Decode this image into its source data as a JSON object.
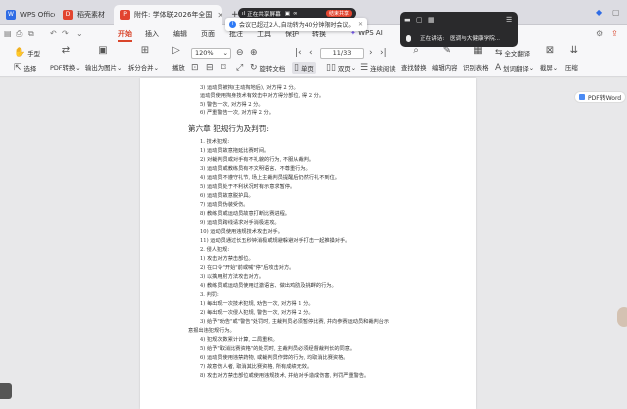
{
  "tabs": [
    {
      "label": "WPS Office"
    },
    {
      "label": "稻壳素材"
    },
    {
      "label": "附件: 学体联2026年全国"
    },
    {
      "label": "+"
    }
  ],
  "menubar": {
    "items": [
      "开始",
      "插入",
      "编辑",
      "页面",
      "批注",
      "工具",
      "保护",
      "转换",
      "WPS AI"
    ],
    "active": "开始"
  },
  "ribbon": {
    "hand_tool": "手型",
    "select_tool": "选择",
    "pdf_convert": "PDF转换",
    "export_image": "输出为图片",
    "split_merge": "拆分合并",
    "play": "播放",
    "zoom": "120%",
    "page_indicator": "11/33",
    "rotate_doc": "旋转文档",
    "single_page": "单页",
    "double_page": "双页",
    "continuous_read": "连续阅读",
    "find_replace": "查找替换",
    "edit_content": "编辑内容",
    "identify_table": "识别表格",
    "full_text_translate": "全文翻译",
    "word_translate": "划词翻译",
    "screenshot": "截屏",
    "compress": "压缩"
  },
  "screen_share": {
    "label": "正在共享屏幕",
    "end": "结束共享"
  },
  "meeting_toast": {
    "text": "会议已超过2人,自动转为40分钟限时会议。"
  },
  "float_panel": {
    "speaking": "正在讲话:",
    "speaker": "医调与大健康学院..."
  },
  "pdf_to_word": "PDF转Word",
  "document": {
    "lines_top": [
      "3) 运动员被掏(主动掏地后), 对方得 2 分。",
      "运动员使用掏身技术有效击中对方得分部位, 得 2 分。",
      "5) 警告一次, 对方得 2 分。",
      "6) 严重警告一次, 对方得 2 分。"
    ],
    "heading": "第六章  犯规行为及判罚:",
    "lines_body": [
      "1. 技术犯规:",
      "1) 运动员故意拖延比赛时间。",
      "2) 对裁判员或对手有不礼貌的行为, 不服从裁判。",
      "3) 运动员或教练员有不文明语言、不尊重行为。",
      "4) 运动员不遵守礼节, 场上主裁判员提醒后仍然行礼不到位。",
      "5) 运动员处于不利状况时有示意求暂停。",
      "6) 运动员故意脱护具。",
      "7) 运动员伪装受伤。",
      "8) 教练员或运动员故意打断比赛进程。",
      "9) 运动员跨线请求对手消极进攻。",
      "10) 运动员使用违规技术攻击对手。",
      "11) 运动员通过长五秒钟消极或规避躲避对手打击一起推搡对手。",
      "2. 侵人犯规:",
      "1) 攻击对方禁击部位。",
      "2) 在口令\"开始\"前或喊\"停\"后攻击对方。",
      "3) 以擒用肘方法攻击对方。",
      "4) 教练员或运动员使用过激语言、做出鸡肋及挑衅的行为。",
      "3. 判罚:",
      "1) 每出现一次技术犯规, 劝告一次, 对方得 1 分。",
      "2) 每出现一次侵人犯规, 警告一次, 对方得 2 分。",
      "3) 给予\"劝告\"或\"警告\"处罚时, 主裁判员必须暂停比赛, 并向参赛运动员和裁判台示",
      "意报出违犯规行为。",
      "4) 犯规次数累计计算, 二局重积。",
      "5) 给予\"取消比赛资格\"的处罚时, 主裁判员必须经督裁判长的同意。",
      "6) 运动员使用违禁药物, 或裁判员作弊的行为, 均取消比赛资格。",
      "7) 故意伤人者, 取消其比赛资格, 所有成绩无效。",
      "8) 攻击对方禁击部位或使用违规技术, 并给对手造成伤害, 判罚严重警告。"
    ]
  },
  "colors": {
    "accent": "#d9452b",
    "info": "#2f7bf6",
    "wps_red": "#e2442f"
  }
}
